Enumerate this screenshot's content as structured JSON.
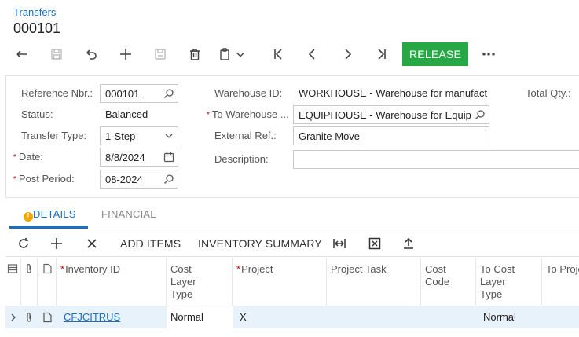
{
  "header": {
    "breadcrumb": "Transfers",
    "title": "000101"
  },
  "toolbar": {
    "release_label": "RELEASE",
    "more_label": "⋯",
    "icons": [
      "back-icon",
      "save-icon",
      "undo-icon",
      "add-icon",
      "copy-save-icon",
      "delete-icon",
      "clipboard-icon",
      "chevron-down-icon",
      "first-icon",
      "previous-icon",
      "next-icon",
      "last-icon"
    ]
  },
  "form": {
    "reference_nbr": {
      "label": "Reference Nbr.:",
      "value": "000101"
    },
    "status": {
      "label": "Status:",
      "value": "Balanced"
    },
    "transfer_type": {
      "label": "Transfer Type:",
      "value": "1-Step"
    },
    "date": {
      "label": "Date:",
      "value": "8/8/2024"
    },
    "post_period": {
      "label": "Post Period:",
      "value": "08-2024"
    },
    "warehouse_id": {
      "label": "Warehouse ID:",
      "value": "WORKHOUSE - Warehouse for manufact"
    },
    "to_warehouse": {
      "label": "To Warehouse ...",
      "value": "EQUIPHOUSE - Warehouse for Equip"
    },
    "external_ref": {
      "label": "External Ref.:",
      "value": "Granite Move"
    },
    "description": {
      "label": "Description:",
      "value": ""
    },
    "total_qty": {
      "label": "Total Qty.:"
    },
    "required_mark": "*"
  },
  "tabs": {
    "details": "DETAILS",
    "financial": "FINANCIAL",
    "warning_mark": "!"
  },
  "grid_toolbar": {
    "add_items": "ADD ITEMS",
    "inventory_summary": "INVENTORY SUMMARY"
  },
  "grid": {
    "columns": {
      "inventory_id": "Inventory ID",
      "cost_layer_type": "Cost Layer Type",
      "project": "Project",
      "project_task": "Project Task",
      "cost_code": "Cost Code",
      "to_cost_layer_type": "To Cost Layer Type",
      "to_project": "To Proje"
    },
    "rows": [
      {
        "inventory_id": "CFJCITRUS",
        "cost_layer_type": "Normal",
        "project": "X",
        "project_task": "",
        "cost_code": "",
        "to_cost_layer_type": "Normal"
      }
    ]
  }
}
